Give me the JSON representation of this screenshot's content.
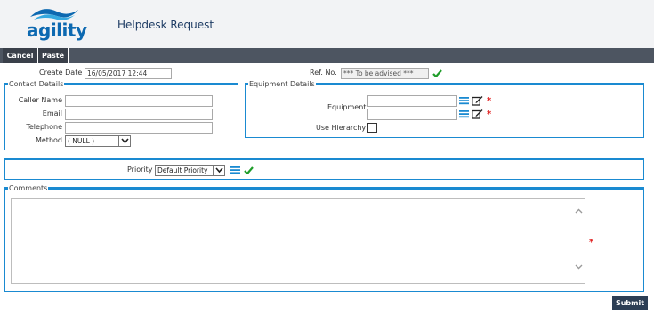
{
  "header": {
    "logo_text": "agility",
    "title": "Helpdesk Request"
  },
  "toolbar": {
    "cancel_label": "Cancel",
    "paste_label": "Paste"
  },
  "meta": {
    "create_date_label": "Create Date",
    "create_date_value": "16/05/2017 12:44",
    "ref_label": "Ref. No.",
    "ref_value": "*** To be advised ***"
  },
  "contact": {
    "legend": "Contact Details",
    "caller_name_label": "Caller Name",
    "email_label": "Email",
    "telephone_label": "Telephone",
    "method_label": "Method",
    "method_value": "( NULL )"
  },
  "equipment": {
    "legend": "Equipment Details",
    "equipment_label": "Equipment",
    "use_hierarchy_label": "Use Hierarchy"
  },
  "priority": {
    "label": "Priority",
    "value": "Default Priority"
  },
  "comments": {
    "legend": "Comments"
  },
  "required_marker": "*",
  "actions": {
    "submit_label": "Submit"
  },
  "colors": {
    "accent": "#1a8ad1",
    "toolbar": "#4d5561",
    "submit": "#2c3e55",
    "ok": "#1f9d2a",
    "required": "#e02020"
  },
  "icons": [
    "list-icon",
    "edit-icon",
    "check-icon",
    "chevron-down-icon",
    "chevron-up-icon"
  ]
}
